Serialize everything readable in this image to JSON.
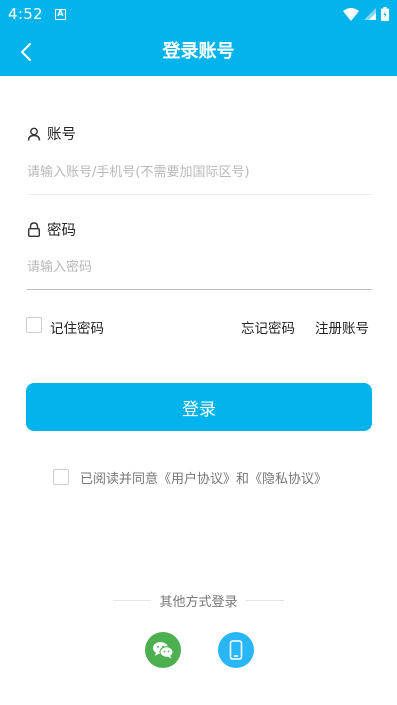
{
  "status_bar": {
    "time": "4:52",
    "notification_glyph": "A"
  },
  "header": {
    "title": "登录账号"
  },
  "form": {
    "account": {
      "label": "账号",
      "placeholder": "请输入账号/手机号(不需要加国际区号)"
    },
    "password": {
      "label": "密码",
      "placeholder": "请输入密码"
    }
  },
  "options": {
    "remember_label": "记住密码",
    "forgot_label": "忘记密码",
    "register_label": "注册账号"
  },
  "login_button": {
    "label": "登录"
  },
  "agreement": {
    "text": "已阅读并同意《用户协议》和《隐私协议》"
  },
  "other_login": {
    "title": "其他方式登录"
  },
  "colors": {
    "brand": "#03b3ec",
    "wechat": "#4caf50",
    "phone": "#29b6f6"
  }
}
